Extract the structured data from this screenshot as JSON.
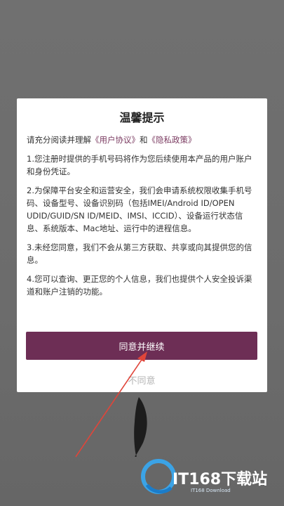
{
  "dialog": {
    "title": "温馨提示",
    "intro_prefix": "请充分阅读并理解",
    "link_user_agreement": "《用户协议》",
    "intro_and": "和",
    "link_privacy_policy": "《隐私政策》",
    "paragraphs": [
      "1.您注册时提供的手机号码将作为您后续使用本产品的用户账户和身份凭证。",
      "2.为保障平台安全和运营安全，我们会申请系统权限收集手机号码、设备型号、设备识别码（包括IMEI/Android ID/OPEN UDID/GUID/SN ID/MEID、IMSI、ICCID）、设备运行状态信息、系统版本、Mac地址、运行中的进程信息。",
      "3.未经您同意，我们不会从第三方获取、共享或向其提供您的信息。",
      "4.您可以查询、更正您的个人信息，我们也提供个人安全投诉渠道和账户注销的功能。"
    ],
    "agree_label": "同意并继续",
    "disagree_label": "不同意"
  },
  "watermark": {
    "brand": "IT168下载站",
    "sub": "IT168 Download"
  },
  "colors": {
    "accent": "#6d2e55",
    "link": "#7b3b61",
    "arrow": "#e0453a"
  }
}
